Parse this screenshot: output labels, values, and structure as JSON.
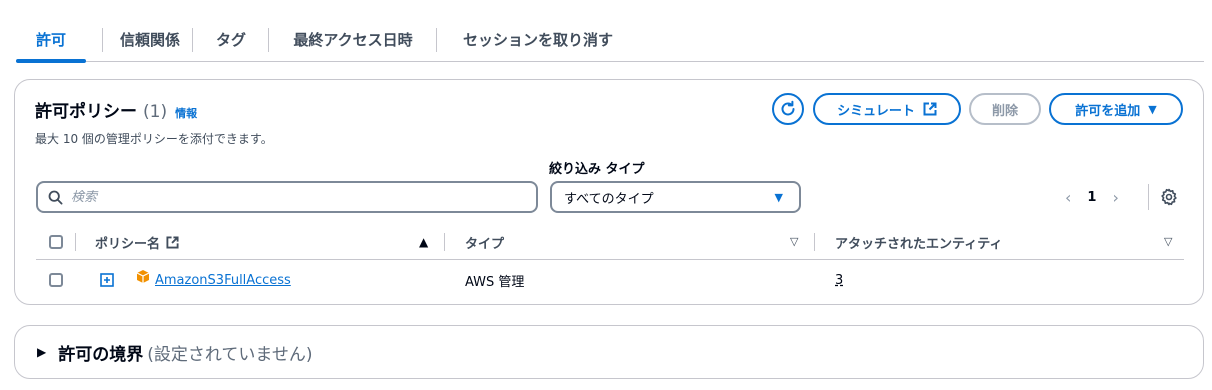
{
  "tabs": [
    {
      "label": "許可",
      "active": true
    },
    {
      "label": "信頼関係",
      "active": false
    },
    {
      "label": "タグ",
      "active": false
    },
    {
      "label": "最終アクセス日時",
      "active": false
    },
    {
      "label": "セッションを取り消す",
      "active": false
    }
  ],
  "policies": {
    "title": "許可ポリシー",
    "count": "(1)",
    "info_link": "情報",
    "description": "最大 10 個の管理ポリシーを添付できます。",
    "buttons": {
      "refresh_icon": "refresh-icon",
      "simulate": "シミュレート",
      "delete": "削除",
      "add": "許可を追加"
    },
    "search": {
      "placeholder": "検索",
      "value": ""
    },
    "filter": {
      "label": "絞り込み タイプ",
      "selected": "すべてのタイプ"
    },
    "pagination": {
      "current_page": "1"
    },
    "columns": {
      "policy_name": "ポリシー名",
      "type": "タイプ",
      "attached_entities": "アタッチされたエンティティ"
    },
    "rows": [
      {
        "name": "AmazonS3FullAccess",
        "type": "AWS 管理",
        "attached": "3"
      }
    ]
  },
  "boundary": {
    "title": "許可の境界",
    "status": "(設定されていません)"
  },
  "colors": {
    "accent": "#0972d3",
    "text": "#000716",
    "muted": "#5f6b7a",
    "border": "#c6c6cd",
    "aws_orange": "#f29100"
  }
}
